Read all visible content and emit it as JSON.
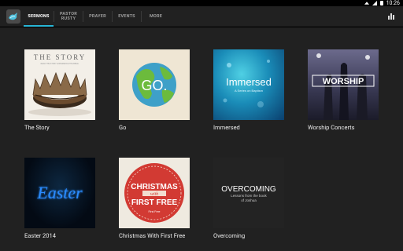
{
  "status_bar": {
    "time": "10:26"
  },
  "tabs": [
    {
      "label": "SERMONS",
      "active": true
    },
    {
      "label": "PASTOR\nRUSTY",
      "active": false
    },
    {
      "label": "PRAYER",
      "active": false
    },
    {
      "label": "EVENTS",
      "active": false
    },
    {
      "label": "MORE",
      "active": false
    }
  ],
  "colors": {
    "accent": "#29b6d6",
    "background": "#212121",
    "app_bar": "#212121"
  },
  "series": [
    {
      "title": "The Story",
      "art_text": "THE STORY",
      "art_subtext": "READ THE STORY. EXPERIENCE THE BIBLE."
    },
    {
      "title": "Go",
      "art_text": "GO."
    },
    {
      "title": "Immersed",
      "art_text": "Immersed",
      "art_subtext": "A Series on Baptism"
    },
    {
      "title": "Worship Concerts",
      "art_text": "WORSHIP"
    },
    {
      "title": "Easter 2014",
      "art_text": "Easter"
    },
    {
      "title": "Christmas With First Free",
      "art_text_line1": "CHRISTMAS",
      "art_text_line2": "with",
      "art_text_line3": "FIRST FREE",
      "art_footer": "First Free"
    },
    {
      "title": "Overcoming",
      "art_text": "OVERCOMING",
      "art_subtext": "Lessons from the book of Joshua"
    }
  ]
}
